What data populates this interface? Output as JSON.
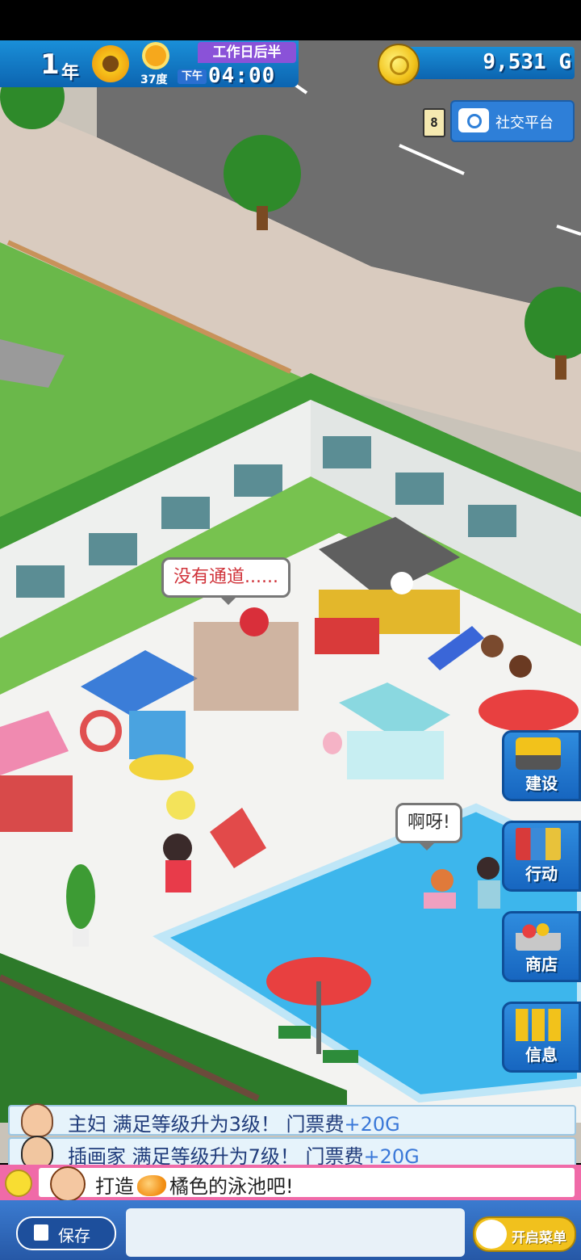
{
  "status": {
    "year_number": "1",
    "year_unit": "年",
    "temperature": "37度",
    "period": "工作日后半",
    "am_pm": "下午",
    "time": "04:00",
    "money": "9,531 G"
  },
  "social": {
    "badge": "8",
    "label": "社交平台"
  },
  "bubbles": {
    "no_path": "没有通道......",
    "oops": "啊呀!"
  },
  "side_menu": [
    {
      "label": "建设",
      "icon": "excavator-icon"
    },
    {
      "label": "行动",
      "icon": "books-icon"
    },
    {
      "label": "商店",
      "icon": "shopping-basket-icon"
    },
    {
      "label": "信息",
      "icon": "bar-chart-icon"
    }
  ],
  "notifications": [
    {
      "text": "主妇 满足等级升为3级！ 门票费",
      "increment": "+20G"
    },
    {
      "text": "插画家 满足等级升为7级！ 门票费",
      "increment": "+20G"
    }
  ],
  "goal": {
    "prefix": "打造",
    "suffix": "橘色的泳池吧!"
  },
  "bottom_bar": {
    "save_label": "保存",
    "menu_label": "开启菜单"
  },
  "colors": {
    "accent_blue": "#1a8fd8",
    "period_purple": "#8a52d8",
    "goal_pink": "#f06aa8",
    "coin_gold": "#f1c21b"
  }
}
